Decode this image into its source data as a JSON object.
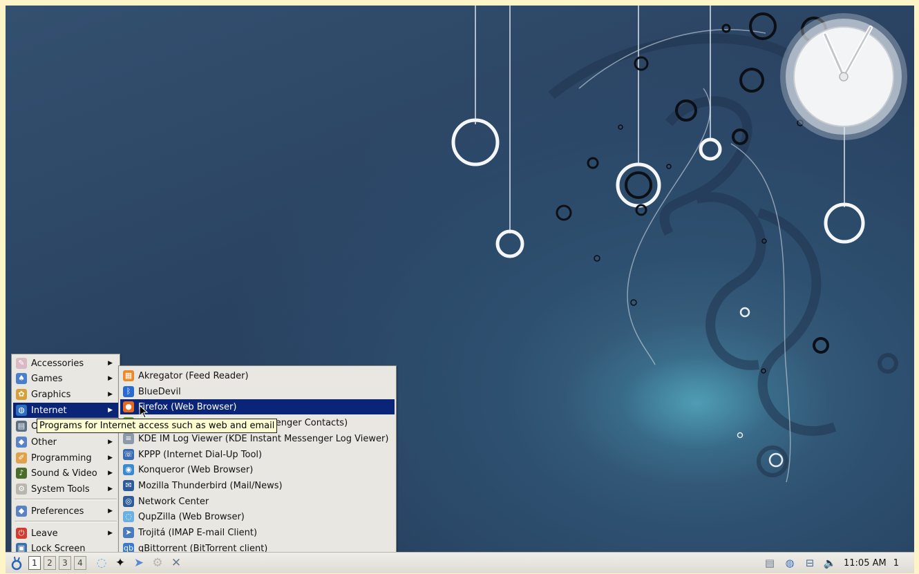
{
  "menu": {
    "items": [
      {
        "label": "Accessories",
        "icon": "accessories-icon",
        "color": "#d9b9c4"
      },
      {
        "label": "Games",
        "icon": "games-icon",
        "color": "#4a7fd0"
      },
      {
        "label": "Graphics",
        "icon": "graphics-icon",
        "color": "#d6a13a"
      },
      {
        "label": "Internet",
        "icon": "internet-globe-icon",
        "color": "#2d6ec0"
      },
      {
        "label": "Office",
        "icon": "office-icon",
        "color": "#5a6f80"
      },
      {
        "label": "Other",
        "icon": "other-icon",
        "color": "#5b82c4"
      },
      {
        "label": "Programming",
        "icon": "programming-icon",
        "color": "#e1a14a"
      },
      {
        "label": "Sound & Video",
        "icon": "sound-video-icon",
        "color": "#4a6d2a"
      },
      {
        "label": "System Tools",
        "icon": "system-tools-icon",
        "color": "#b9b6ae"
      },
      {
        "label": "Preferences",
        "icon": "preferences-icon",
        "color": "#5b82c4"
      },
      {
        "label": "Leave",
        "icon": "leave-power-icon",
        "color": "#d53a2e"
      },
      {
        "label": "Lock Screen",
        "icon": "lock-screen-icon",
        "color": "#3d6fa8"
      }
    ]
  },
  "submenu": {
    "items": [
      {
        "label": "Akregator (Feed Reader)",
        "icon": "akregator-icon",
        "color": "#e8892a"
      },
      {
        "label": "BlueDevil",
        "icon": "bluetooth-icon",
        "color": "#2a6ad0"
      },
      {
        "label": "Firefox (Web Browser)",
        "icon": "firefox-icon",
        "color": "#e56a1f"
      },
      {
        "label": "KDE IM Contacts (Instant Messenger Contacts)",
        "icon": "kde-im-contacts-icon",
        "color": "#6a9a3a"
      },
      {
        "label": "KDE IM Log Viewer (KDE Instant Messenger Log Viewer)",
        "icon": "log-viewer-icon",
        "color": "#8a9aaa"
      },
      {
        "label": "KPPP (Internet Dial-Up Tool)",
        "icon": "kppp-icon",
        "color": "#3a6ab0"
      },
      {
        "label": "Konqueror (Web Browser)",
        "icon": "konqueror-icon",
        "color": "#3a8ad0"
      },
      {
        "label": "Mozilla Thunderbird (Mail/News)",
        "icon": "thunderbird-icon",
        "color": "#2c5a9a"
      },
      {
        "label": "Network Center",
        "icon": "network-center-icon",
        "color": "#2f5d9a"
      },
      {
        "label": "QupZilla (Web Browser)",
        "icon": "qupzilla-icon",
        "color": "#6ab0e0"
      },
      {
        "label": "Trojitá (IMAP E-mail Client)",
        "icon": "trojita-icon",
        "color": "#4a7ac0"
      },
      {
        "label": "qBittorrent (BitTorrent client)",
        "icon": "qbittorrent-icon",
        "color": "#3a7ad0"
      }
    ]
  },
  "tooltip": "Programs for Internet access such as web and email",
  "taskbar": {
    "workspaces": [
      "1",
      "2",
      "3",
      "4"
    ],
    "launchers": [
      "qupzilla-launcher-icon",
      "mandriva-launcher-icon",
      "mail-launcher-icon",
      "settings-gear-icon",
      "tools-icon"
    ],
    "clock": "11:05 AM",
    "desktop_number": "1",
    "tray": [
      "notes-icon",
      "network-globe-icon",
      "network-monitor-icon",
      "volume-icon"
    ]
  }
}
